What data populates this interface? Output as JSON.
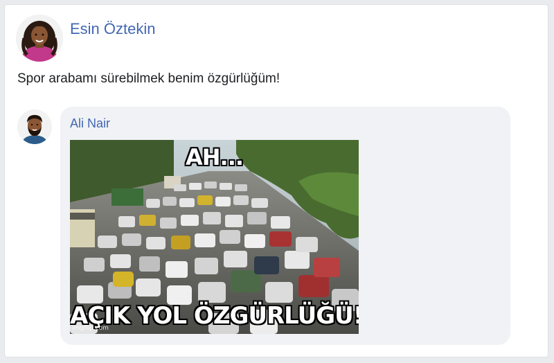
{
  "post": {
    "author": "Esin Öztekin",
    "text": "Spor arabamı sürebilmek benim özgürlüğüm!",
    "avatar_icon": "woman-avatar-icon"
  },
  "comment": {
    "author": "Ali Nair",
    "avatar_icon": "man-avatar-icon",
    "meme": {
      "top_text": "AH...",
      "bottom_text": "AÇIK YOL ÖZGÜRLÜĞÜ!",
      "watermark": "imgflip.com"
    }
  },
  "colors": {
    "link": "#4267b2",
    "bubble": "#f0f2f5",
    "page_bg": "#e9ebee"
  }
}
